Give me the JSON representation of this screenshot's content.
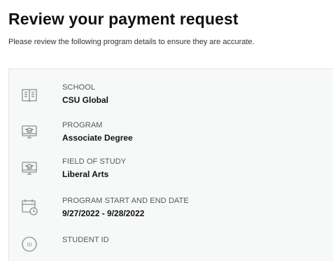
{
  "header": {
    "title": "Review your payment request",
    "subtitle": "Please review the following program details to ensure they are accurate."
  },
  "details": [
    {
      "label": "SCHOOL",
      "value": "CSU Global",
      "icon": "book-icon"
    },
    {
      "label": "PROGRAM",
      "value": "Associate Degree",
      "icon": "monitor-graduation-icon"
    },
    {
      "label": "FIELD OF STUDY",
      "value": "Liberal Arts",
      "icon": "monitor-graduation-icon"
    },
    {
      "label": "PROGRAM START AND END DATE",
      "value": "9/27/2022 - 9/28/2022",
      "icon": "calendar-clock-icon"
    },
    {
      "label": "STUDENT ID",
      "value": "",
      "icon": "id-badge-icon"
    }
  ],
  "colors": {
    "card_background": "#f7f8f8",
    "icon_stroke": "#8a8f91",
    "label_text": "#565959"
  }
}
